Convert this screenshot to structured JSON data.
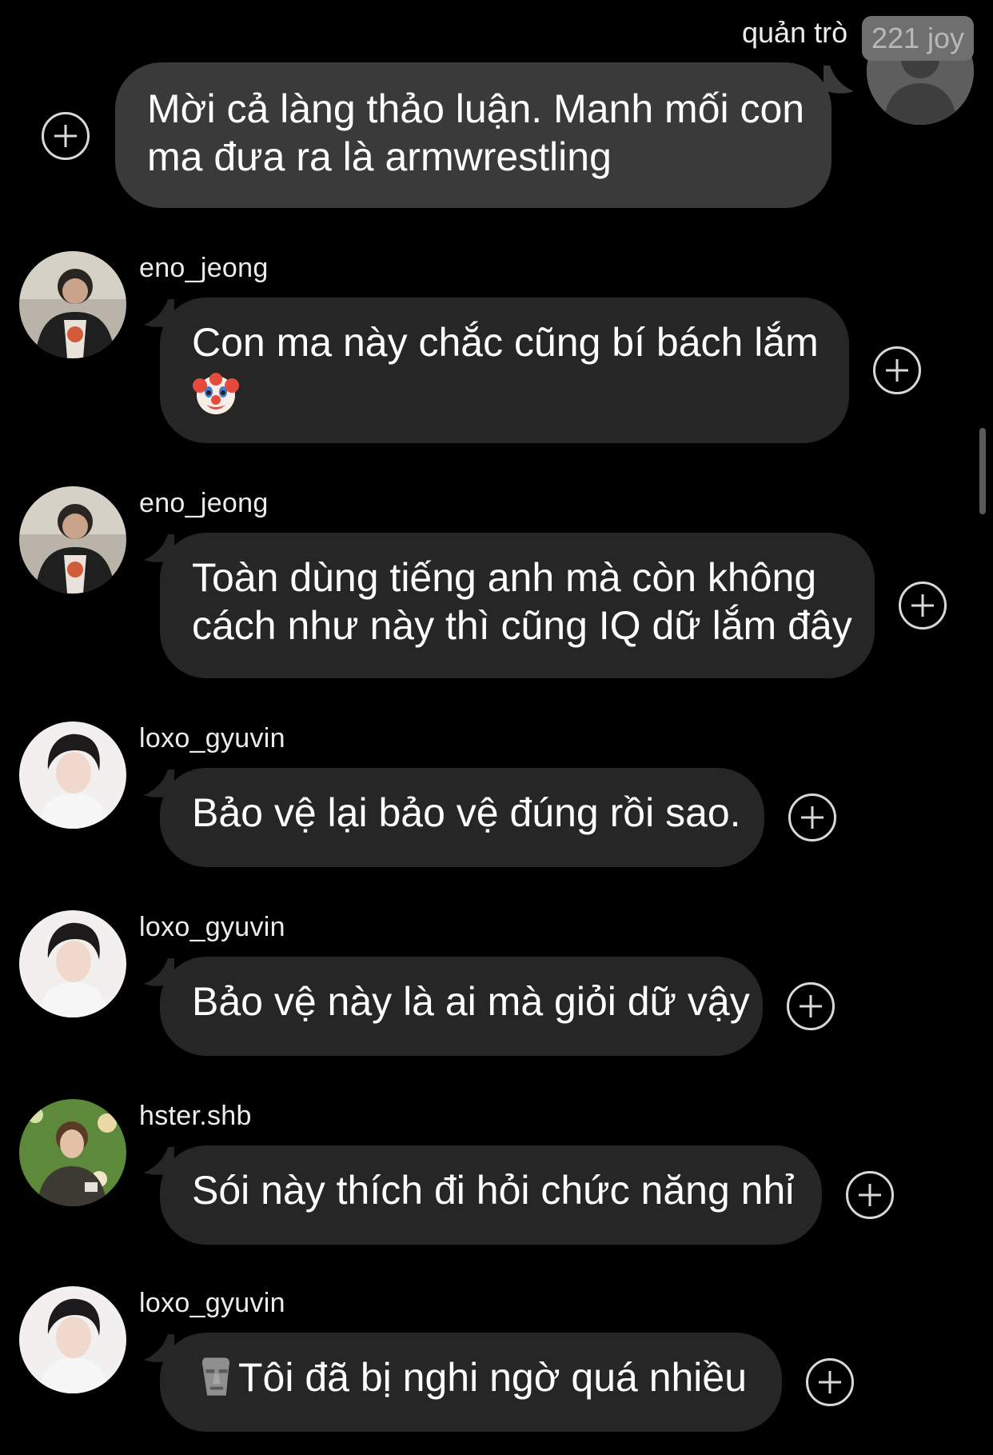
{
  "host": {
    "name": "quản trò",
    "badge": "221 joy",
    "message_lines": [
      "Mời cả làng thảo luận. Manh mối con",
      "ma đưa ra là armwrestling"
    ]
  },
  "messages": [
    {
      "sender": "eno_jeong",
      "lines": [
        "Con ma này chắc cũng bí bách lắm",
        ""
      ],
      "emoji": "clown-face"
    },
    {
      "sender": "eno_jeong",
      "lines": [
        "Toàn dùng tiếng anh mà còn không",
        "cách như này thì cũng IQ dữ lắm đây"
      ]
    },
    {
      "sender": "loxo_gyuvin",
      "lines": [
        "Bảo vệ lại bảo vệ đúng rồi sao."
      ]
    },
    {
      "sender": "loxo_gyuvin",
      "lines": [
        "Bảo vệ này là ai mà giỏi dữ vậy"
      ]
    },
    {
      "sender": "hster.shb",
      "lines": [
        "Sói này thích đi hỏi chức năng nhỉ"
      ]
    },
    {
      "sender": "loxo_gyuvin",
      "lines": [
        "Tôi đã bị nghi ngờ quá nhiều"
      ],
      "emoji": "moai"
    }
  ],
  "colors": {
    "background": "#000000",
    "bubble": "#262626",
    "host_bubble": "#3a3a3a",
    "text": "#ffffff"
  }
}
